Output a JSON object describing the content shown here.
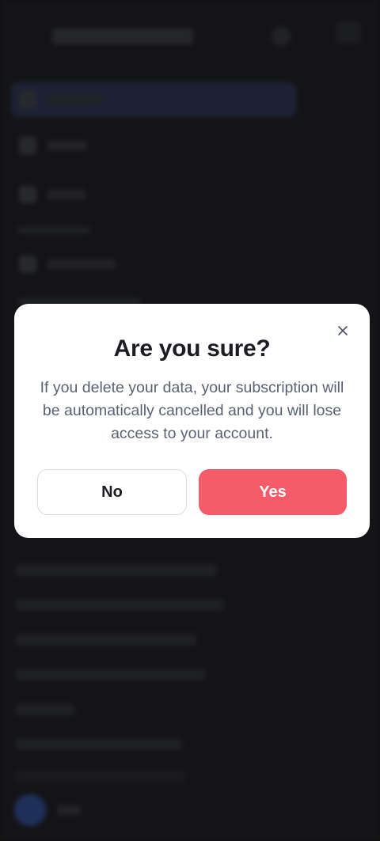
{
  "dialog": {
    "title": "Are you sure?",
    "message": "If you delete your data, your subscription will be automatically cancelled and you will lose access to your account.",
    "no_label": "No",
    "yes_label": "Yes",
    "close_icon": "close-icon"
  },
  "colors": {
    "confirm_accent": "#f65b69",
    "title_text": "#1b1d22",
    "body_text": "#5a6272",
    "overlay": "rgba(0,0,0,0.35)"
  }
}
